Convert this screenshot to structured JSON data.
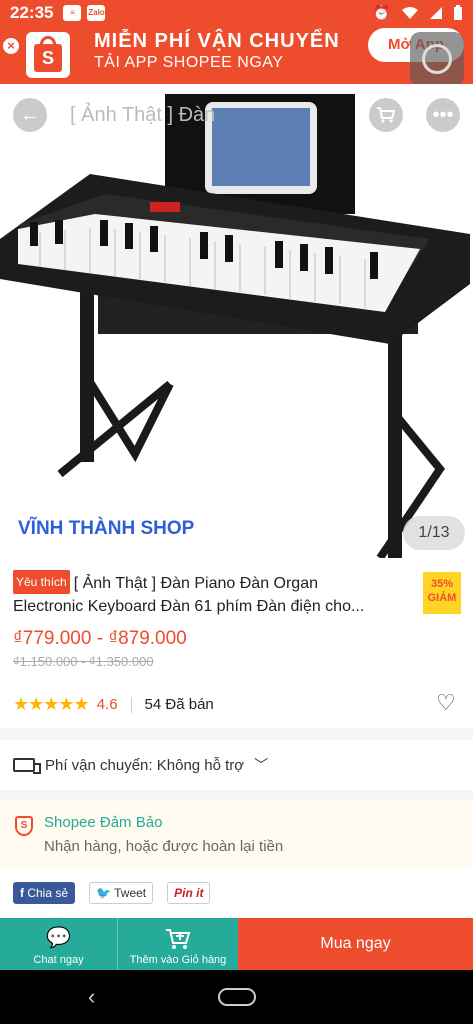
{
  "status_bar": {
    "time": "22:35",
    "icons": [
      "message-icon",
      "zalo-icon",
      "alarm-icon",
      "wifi-icon",
      "signal-icon",
      "battery-icon"
    ],
    "zalo_label": "Zalo"
  },
  "banner": {
    "line1": "MIỄN PHÍ VẬN CHUYỂN",
    "line2": "TẢI APP SHOPEE NGAY",
    "open_app": "Mở App",
    "close": "×"
  },
  "header": {
    "title": "[ Ảnh Thật ] Đàn"
  },
  "gallery": {
    "shop_name": "VĨNH THÀNH SHOP",
    "counter": "1/13"
  },
  "product": {
    "tag": "Yêu thích",
    "title_line1": "[ Ảnh Thật ] Đàn Piano Đàn Organ",
    "title_line2": "Electronic Keyboard Đàn 61 phím Đàn điện cho...",
    "discount_pct": "35%",
    "discount_label": "GIẢM",
    "price": "₫779.000 - ₫879.000",
    "old_price": "₫1.150.000 - ₫1.350.000",
    "stars": "★★★★★",
    "rating": "4.6",
    "sold": "54 Đã bán"
  },
  "shipping": {
    "label": "Phí vận chuyển:",
    "value": "Không hỗ trợ"
  },
  "guarantee": {
    "title": "Shopee Đảm Bảo",
    "subtitle": "Nhận hàng, hoặc được hoàn lại tiền"
  },
  "share": {
    "facebook": "Chia sẻ",
    "twitter": "Tweet",
    "pinterest": "Pin it"
  },
  "actions": {
    "chat": "Chat ngay",
    "add_cart": "Thêm vào Giỏ hàng",
    "buy": "Mua ngay"
  },
  "colors": {
    "brand": "#ee4d2d",
    "teal": "#26aa99",
    "star": "#ffb400"
  }
}
